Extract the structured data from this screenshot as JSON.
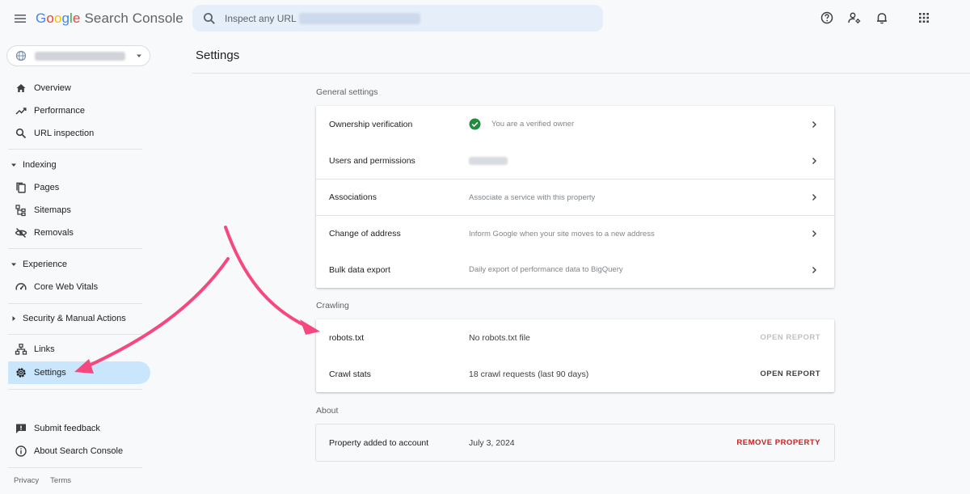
{
  "header": {
    "logo_letters": [
      "G",
      "o",
      "o",
      "g",
      "l",
      "e"
    ],
    "product_name": "Search Console",
    "search_placeholder": "Inspect any URL in"
  },
  "sidebar": {
    "nav_top": [
      {
        "label": "Overview",
        "icon": "home-icon"
      },
      {
        "label": "Performance",
        "icon": "trending-icon"
      },
      {
        "label": "URL inspection",
        "icon": "search-icon"
      }
    ],
    "indexing": {
      "heading": "Indexing",
      "items": [
        {
          "label": "Pages",
          "icon": "pages-icon"
        },
        {
          "label": "Sitemaps",
          "icon": "sitemap-icon"
        },
        {
          "label": "Removals",
          "icon": "eye-off-icon"
        }
      ]
    },
    "experience": {
      "heading": "Experience",
      "items": [
        {
          "label": "Core Web Vitals",
          "icon": "speed-icon"
        }
      ]
    },
    "security": {
      "heading": "Security & Manual Actions"
    },
    "nav_bottom": [
      {
        "label": "Links",
        "icon": "links-icon"
      },
      {
        "label": "Settings",
        "icon": "gear-icon",
        "active": true
      }
    ],
    "footer_items": [
      {
        "label": "Submit feedback",
        "icon": "feedback-icon"
      },
      {
        "label": "About Search Console",
        "icon": "info-icon"
      }
    ],
    "links": [
      "Privacy",
      "Terms"
    ]
  },
  "main": {
    "title": "Settings",
    "general": {
      "label": "General settings",
      "rows": [
        {
          "label": "Ownership verification",
          "detail": "You are a verified owner"
        },
        {
          "label": "Users and permissions",
          "detail": ""
        },
        {
          "label": "Associations",
          "detail": "Associate a service with this property"
        },
        {
          "label": "Change of address",
          "detail": "Inform Google when your site moves to a new address"
        },
        {
          "label": "Bulk data export",
          "detail": "Daily export of performance data to BigQuery"
        }
      ]
    },
    "crawling": {
      "label": "Crawling",
      "rows": [
        {
          "label": "robots.txt",
          "detail": "No robots.txt file",
          "action": "OPEN REPORT"
        },
        {
          "label": "Crawl stats",
          "detail": "18 crawl requests (last 90 days)",
          "action": "OPEN REPORT"
        }
      ]
    },
    "about": {
      "label": "About",
      "rows": [
        {
          "label": "Property added to account",
          "detail": "July 3, 2024",
          "action": "REMOVE PROPERTY"
        }
      ]
    }
  },
  "colors": {
    "accent_blue": "#1a73e8",
    "active_nav_bg": "#c9e6fd",
    "verified_green": "#1e8e3e",
    "danger_red": "#c5221f",
    "annotation_pink": "#f5487f"
  }
}
